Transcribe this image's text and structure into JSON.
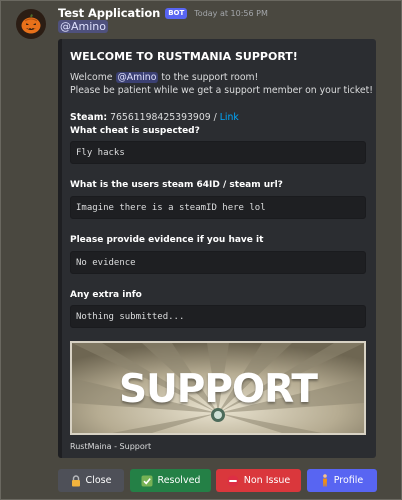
{
  "message": {
    "username": "Test Application",
    "bot_tag": "BOT",
    "timestamp": "Today at 10:56 PM",
    "mention": "@Amino"
  },
  "embed": {
    "title": "WELCOME TO RUSTMANIA SUPPORT!",
    "welcome_prefix": "Welcome",
    "welcome_mention": "@Amino",
    "welcome_suffix": "to the support room!",
    "patience_line": "Please be patient while we get a support member on your ticket!",
    "steam_label": "Steam:",
    "steam_id": "76561198425393909 /",
    "steam_link": "Link",
    "fields": [
      {
        "name": "What cheat is suspected?",
        "value": "Fly hacks"
      },
      {
        "name": "What is the users steam 64ID / steam url?",
        "value": "Imagine there is a steamID here lol"
      },
      {
        "name": "Please provide evidence if you have it",
        "value": "No evidence"
      },
      {
        "name": "Any extra info",
        "value": "Nothing submitted..."
      }
    ],
    "image_text": "SUPPORT",
    "footer": "RustMaina - Support"
  },
  "buttons": {
    "close": "Close",
    "resolved": "Resolved",
    "non_issue": "Non Issue",
    "profile": "Profile"
  },
  "icons": {
    "avatar": "pumpkin-icon",
    "close": "lock-icon",
    "resolved": "check-box-icon",
    "non_issue": "no-entry-icon",
    "profile": "person-icon"
  },
  "colors": {
    "background": "#4a4840",
    "embed": "#2b2d31",
    "link": "#00a8fc",
    "blurple": "#5865f2",
    "success": "#248046",
    "danger": "#da373c",
    "secondary": "#4e5058"
  }
}
